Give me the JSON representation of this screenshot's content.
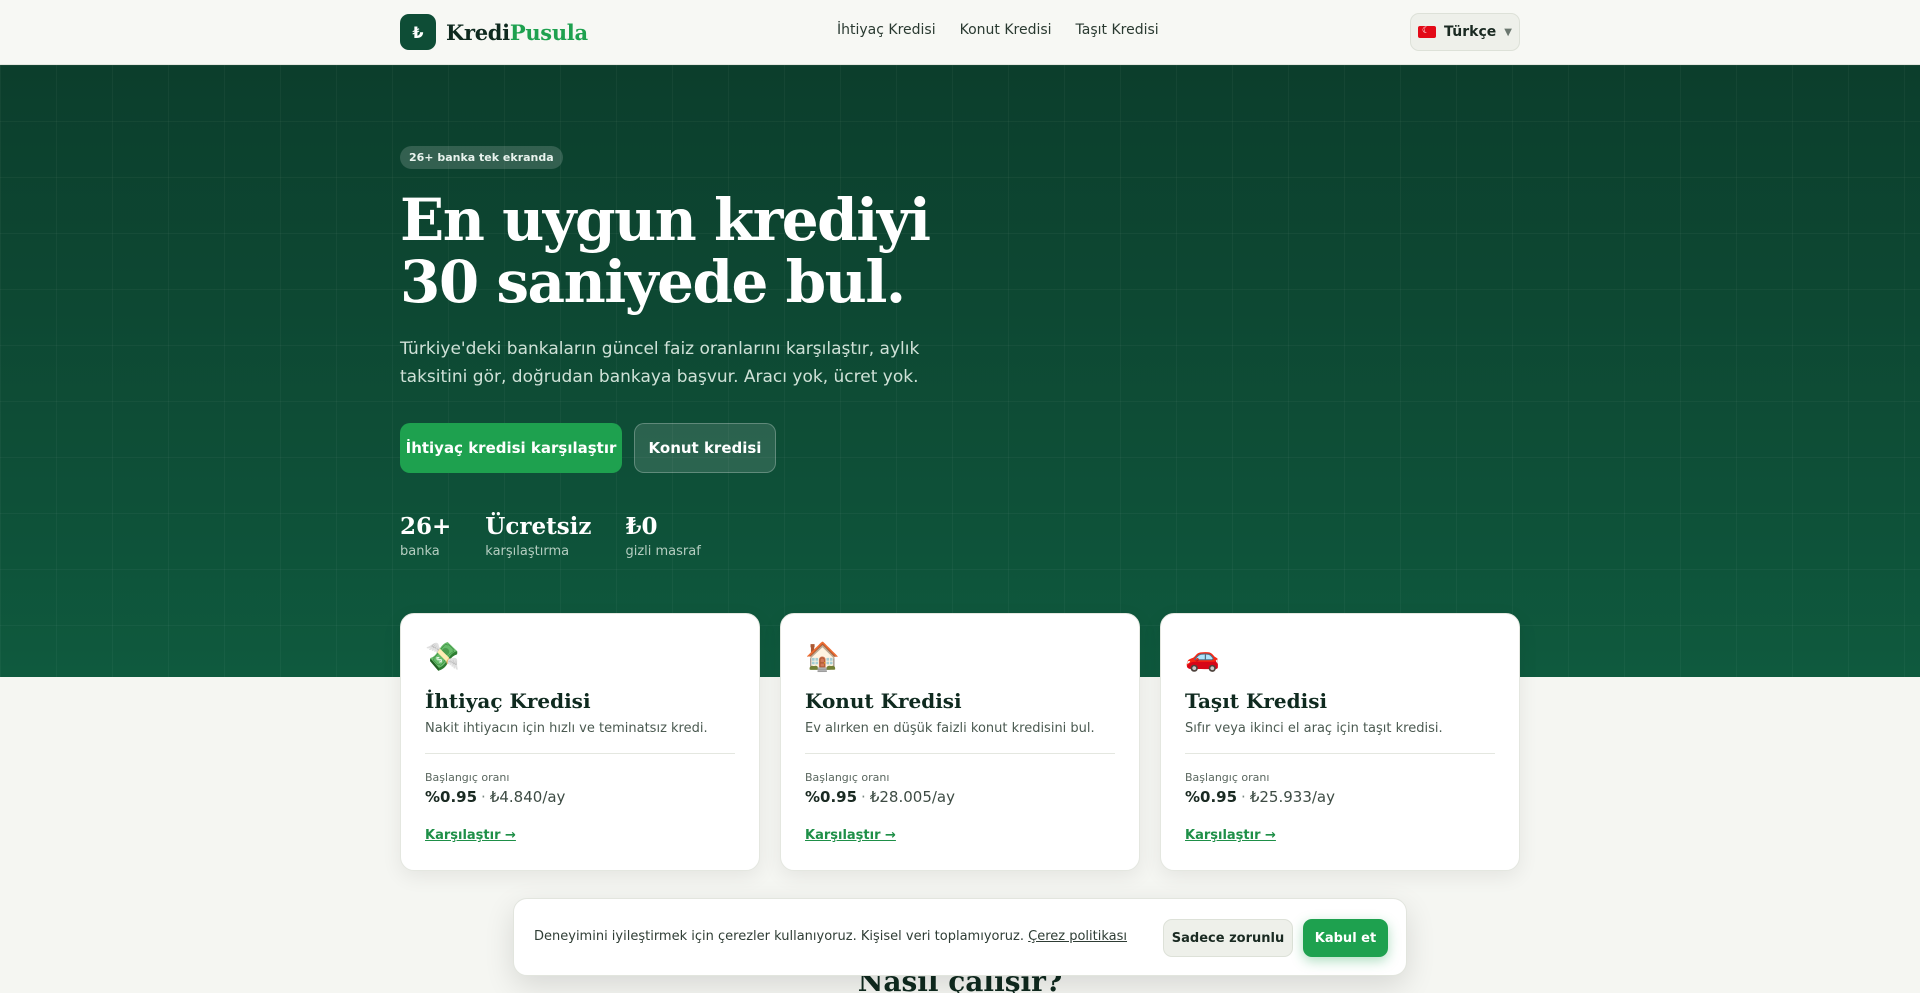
{
  "header": {
    "logo_mark": "₺",
    "logo_main": "Kredi",
    "logo_accent": "Pusula",
    "nav": [
      {
        "label": "İhtiyaç Kredisi"
      },
      {
        "label": "Konut Kredisi"
      },
      {
        "label": "Taşıt Kredisi"
      }
    ],
    "language": "Türkçe"
  },
  "hero": {
    "badge": "26+ banka tek ekranda",
    "headline": "En uygun krediyi 30 saniyede bul.",
    "subhead": "Türkiye'deki bankaların güncel faiz oranlarını karşılaştır, aylık taksitini gör, doğrudan bankaya başvur. Aracı yok, ücret yok.",
    "primary_button": "İhtiyaç kredisi karşılaştır",
    "secondary_button": "Konut kredisi",
    "stats": [
      {
        "value": "26+",
        "label": "banka"
      },
      {
        "value": "Ücretsiz",
        "label": "karşılaştırma"
      },
      {
        "value": "₺0",
        "label": "gizli masraf"
      }
    ]
  },
  "cards": [
    {
      "icon": "money-icon",
      "glyph": "💸",
      "title": "İhtiyaç Kredisi",
      "desc": "Nakit ihtiyacın için hızlı ve teminatsız kredi.",
      "rate_label": "Başlangıç oranı",
      "rate": "%0.95",
      "separator": "·",
      "monthly": "₺4.840/ay",
      "link": "Karşılaştır →"
    },
    {
      "icon": "house-icon",
      "glyph": "🏠",
      "title": "Konut Kredisi",
      "desc": "Ev alırken en düşük faizli konut kredisini bul.",
      "rate_label": "Başlangıç oranı",
      "rate": "%0.95",
      "separator": "·",
      "monthly": "₺28.005/ay",
      "link": "Karşılaştır →"
    },
    {
      "icon": "car-icon",
      "glyph": "🚗",
      "title": "Taşıt Kredisi",
      "desc": "Sıfır veya ikinci el araç için taşıt kredisi.",
      "rate_label": "Başlangıç oranı",
      "rate": "%0.95",
      "separator": "·",
      "monthly": "₺25.933/ay",
      "link": "Karşılaştır →"
    }
  ],
  "section": {
    "title": "Nasıl çalışır?"
  },
  "cookie": {
    "text": "Deneyimini iyileştirmek için çerezler kullanıyoruz. Kişisel veri toplamıyoruz.",
    "policy_link": "Çerez politikası",
    "necessary_button": "Sadece zorunlu",
    "accept_button": "Kabul et"
  },
  "colors": {
    "brand_dark": "#0e4d36",
    "accent_green": "#1ea14f"
  }
}
